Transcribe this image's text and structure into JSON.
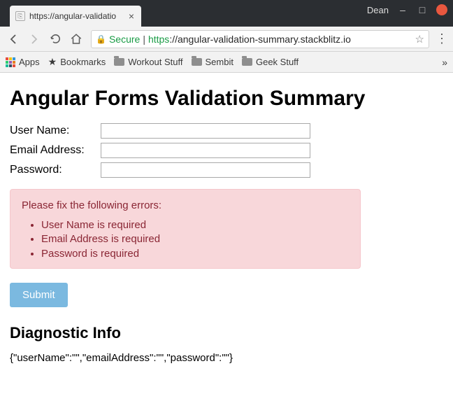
{
  "window": {
    "user_label": "Dean",
    "tab_title": "https://angular-validatio"
  },
  "toolbar": {
    "secure_label": "Secure",
    "url_protocol": "https",
    "url_host": "://angular-validation-summary.stackblitz.io"
  },
  "bookmarks": {
    "apps": "Apps",
    "items": [
      "Bookmarks",
      "Workout Stuff",
      "Sembit",
      "Geek Stuff"
    ],
    "more": "»"
  },
  "page": {
    "title": "Angular Forms Validation Summary",
    "form": {
      "labels": {
        "username": "User Name:",
        "email": "Email Address:",
        "password": "Password:"
      },
      "values": {
        "username": "",
        "email": "",
        "password": ""
      }
    },
    "errors": {
      "heading": "Please fix the following errors:",
      "items": [
        "User Name is required",
        "Email Address is required",
        "Password is required"
      ]
    },
    "submit_label": "Submit",
    "diagnostic": {
      "title": "Diagnostic Info",
      "text": "{\"userName\":\"\",\"emailAddress\":\"\",\"password\":\"\"}"
    }
  }
}
